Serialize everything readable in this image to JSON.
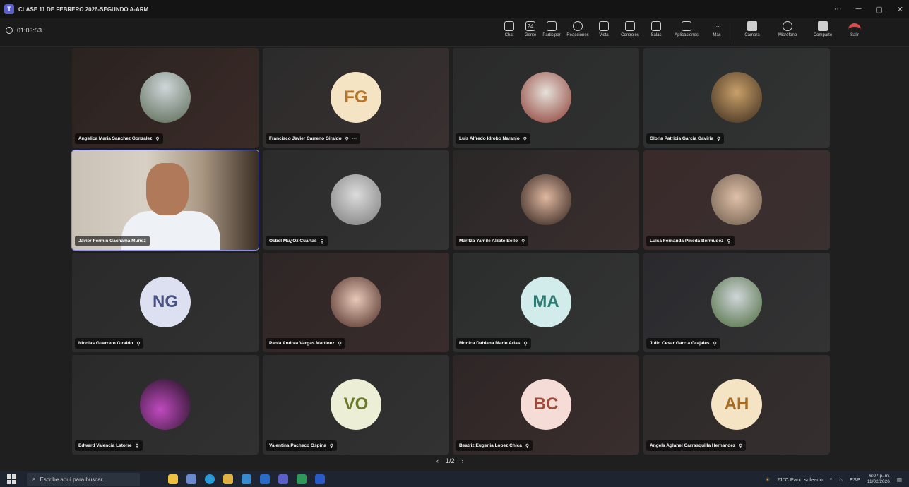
{
  "window": {
    "title": "CLASE 11 DE FEBRERO 2026-SEGUNDO A-ARM",
    "controls": [
      "···",
      "─",
      "▢",
      "✕"
    ]
  },
  "meeting": {
    "timer": "01:03:53"
  },
  "toolbar": {
    "items": [
      {
        "label": "Chat",
        "icon": "chat-icon"
      },
      {
        "label": "Gente",
        "icon": "people-icon",
        "count": "24"
      },
      {
        "label": "Participar",
        "icon": "raise-hand-icon"
      },
      {
        "label": "Reacciones",
        "icon": "emoji-icon"
      },
      {
        "label": "Vista",
        "icon": "grid-icon"
      },
      {
        "label": "Controles",
        "icon": "controls-icon"
      },
      {
        "label": "Salas",
        "icon": "rooms-icon"
      },
      {
        "label": "Aplicaciones",
        "icon": "plus-icon"
      },
      {
        "label": "Más",
        "icon": "more-icon"
      }
    ],
    "camera": "Cámara",
    "microphone": "Micrófono",
    "share": "Comparte",
    "leave": "Salir"
  },
  "participants": [
    {
      "name": "Angelica Maria Sanchez Gonzalez",
      "avatar_type": "photo"
    },
    {
      "name": "Francisco Javier Carreno Giraldo",
      "avatar_type": "initials",
      "initials": "FG",
      "extra": "···"
    },
    {
      "name": "Luis Alfredo Idrobo Naranjo",
      "avatar_type": "photo"
    },
    {
      "name": "Gloria Patricia Garcia Gaviria",
      "avatar_type": "photo"
    },
    {
      "name": "Javier Fermin Gachama Muñoz",
      "avatar_type": "video"
    },
    {
      "name": "Osbel Mu¿Oz Cuartas",
      "avatar_type": "photo"
    },
    {
      "name": "Maritza Yamile Alzate Bello",
      "avatar_type": "photo"
    },
    {
      "name": "Luisa Fernanda Pineda Bermudez",
      "avatar_type": "photo"
    },
    {
      "name": "Nicolas Guerrero Giraldo",
      "avatar_type": "initials",
      "initials": "NG"
    },
    {
      "name": "Paola Andrea Vargas Martinez",
      "avatar_type": "photo"
    },
    {
      "name": "Monica Dahiana Marin Arias",
      "avatar_type": "initials",
      "initials": "MA"
    },
    {
      "name": "Julio Cesar Garcia Grajales",
      "avatar_type": "photo"
    },
    {
      "name": "Edward Valencia Latorre",
      "avatar_type": "photo"
    },
    {
      "name": "Valentina Pacheco Ospina",
      "avatar_type": "initials",
      "initials": "VO"
    },
    {
      "name": "Beatriz Eugenia Lopez Chica",
      "avatar_type": "initials",
      "initials": "BC"
    },
    {
      "name": "Angela Aglahel Carrasquilla Hernandez",
      "avatar_type": "initials",
      "initials": "AH"
    }
  ],
  "pager": {
    "prev": "‹",
    "page": "1/2",
    "next": "›"
  },
  "taskbar": {
    "search_placeholder": "Escribe aquí para buscar.",
    "weather": "21°C  Parc. soleado",
    "lang": "ESP",
    "time": "6:07 p. m.",
    "date": "11/02/2026"
  }
}
